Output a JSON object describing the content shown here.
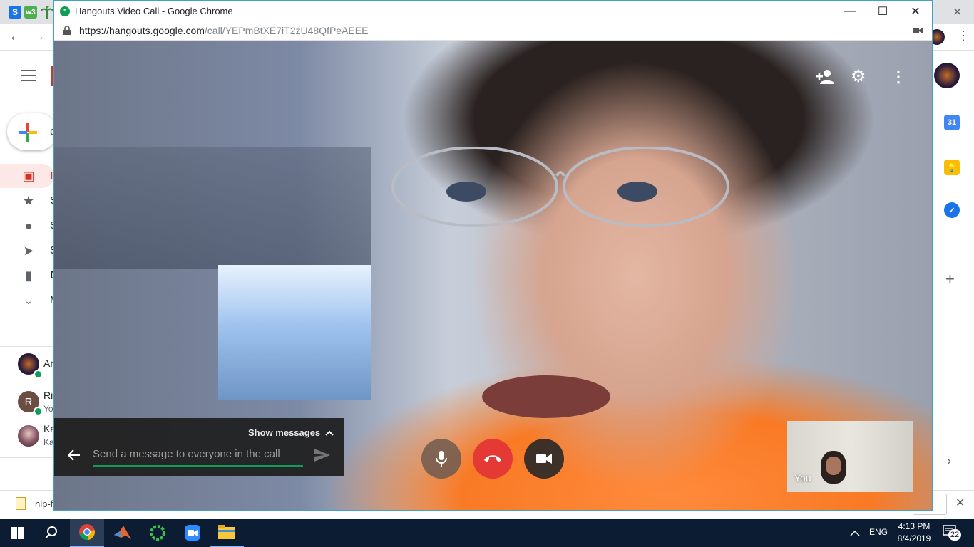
{
  "bg": {
    "favicons": [
      {
        "label": "S",
        "color": "#1a73e8"
      },
      {
        "label": "w3",
        "color": "#4caf50"
      }
    ],
    "nav_letters": [
      "I",
      "S",
      "S",
      "S",
      "D",
      "M"
    ],
    "contacts": [
      {
        "initial": "",
        "name": "An",
        "sub": ""
      },
      {
        "initial": "R",
        "name": "Ri",
        "sub": "Yo"
      },
      {
        "initial": "",
        "name": "Ka",
        "sub": "Ka"
      }
    ],
    "calendar_day": "31",
    "download_name": "nlp-f",
    "download_button": "ll"
  },
  "hangouts": {
    "title": "Hangouts Video Call - Google Chrome",
    "url_host": "https://hangouts.google.com",
    "url_path": "/call/YEPmBtXE7iT2zU48QfPeAEEE",
    "show_messages": "Show messages",
    "message_placeholder": "Send a message to everyone in the call",
    "self_label": "You"
  },
  "taskbar": {
    "language": "ENG",
    "time": "4:13 PM",
    "date": "8/4/2019",
    "notification_count": "22"
  },
  "colors": {
    "hangup": "#e53935",
    "taskbar": "#0c1c33",
    "send_underline": "#0f9d58"
  }
}
